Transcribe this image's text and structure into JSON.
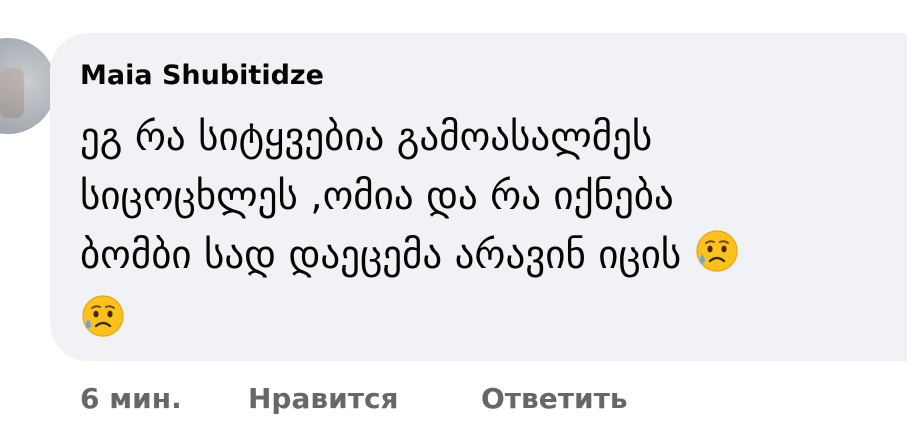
{
  "comment": {
    "author": "Maia Shubitidze",
    "text": "ეგ რა სიტყვებია გამოასალმეს\nსიცოცხლეს ,ომია და რა იქნება\nბომბი სად დაეცემა არავინ იცის ",
    "emoji_icon": "sad-but-relieved-face-icon",
    "emoji_count": 2
  },
  "actions": {
    "time": "6 мин.",
    "like_label": "Нравится",
    "reply_label": "Ответить"
  },
  "colors": {
    "bubble": "#f0f2f5",
    "text": "#050505",
    "secondary": "#65676b"
  }
}
